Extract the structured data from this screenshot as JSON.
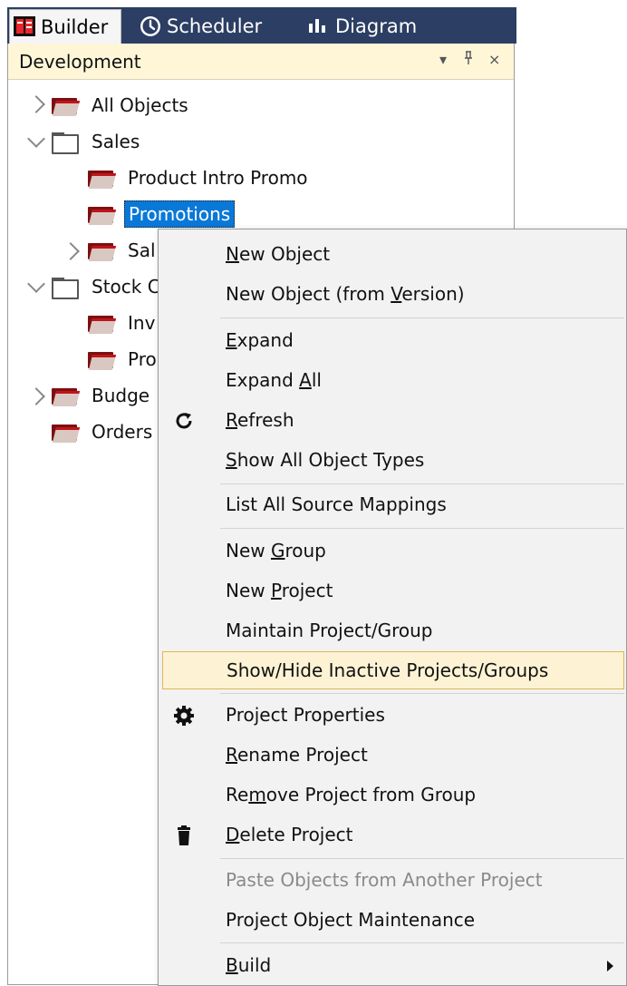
{
  "tabs": [
    {
      "label": "Builder",
      "icon": "builder-icon",
      "active": true
    },
    {
      "label": "Scheduler",
      "icon": "clock-icon",
      "active": false
    },
    {
      "label": "Diagram",
      "icon": "bar-chart-icon",
      "active": false
    }
  ],
  "panel": {
    "title": "Development",
    "controls": [
      "▾",
      "ᵖ",
      "×"
    ]
  },
  "tree": {
    "all_objects": "All Objects",
    "sales": "Sales",
    "product_intro_promo": "Product Intro Promo",
    "promotions": "Promotions",
    "sales_child_partial": "Sal",
    "stock": "Stock C",
    "inv": "Inv",
    "pro": "Pro",
    "budget": "Budge",
    "orders": "Orders"
  },
  "menu": {
    "new_object": {
      "pre": "",
      "acc": "N",
      "post": "ew Object"
    },
    "new_object_version": {
      "pre": "New Object (from ",
      "acc": "V",
      "post": "ersion)"
    },
    "expand": {
      "pre": "",
      "acc": "E",
      "post": "xpand"
    },
    "expand_all": {
      "pre": "Expand ",
      "acc": "A",
      "post": "ll"
    },
    "refresh": {
      "pre": "",
      "acc": "R",
      "post": "efresh"
    },
    "show_all_types": {
      "pre": "",
      "acc": "S",
      "post": "how All Object Types"
    },
    "list_source_mappings": "List All Source Mappings",
    "new_group": {
      "pre": "New ",
      "acc": "G",
      "post": "roup"
    },
    "new_project": {
      "pre": "New ",
      "acc": "P",
      "post": "roject"
    },
    "maintain_project_group": "Maintain Project/Group",
    "show_hide_inactive": "Show/Hide Inactive Projects/Groups",
    "project_properties": "Project Properties",
    "rename_project": {
      "pre": "",
      "acc": "R",
      "post": "ename Project"
    },
    "remove_project": {
      "pre": "Re",
      "acc": "m",
      "post": "ove Project from Group"
    },
    "delete_project": {
      "pre": "",
      "acc": "D",
      "post": "elete Project"
    },
    "paste_objects": "Paste Objects from Another Project",
    "project_object_maintenance": "Project Object Maintenance",
    "build": {
      "pre": "",
      "acc": "B",
      "post": "uild"
    }
  },
  "colors": {
    "tab_strip": "#2c3e63",
    "panel_header": "#fff6d8",
    "selection": "#0a78d7",
    "menu_bg": "#f2f2f2",
    "menu_highlight": "#fdf3d4",
    "menu_highlight_border": "#e0b652"
  }
}
